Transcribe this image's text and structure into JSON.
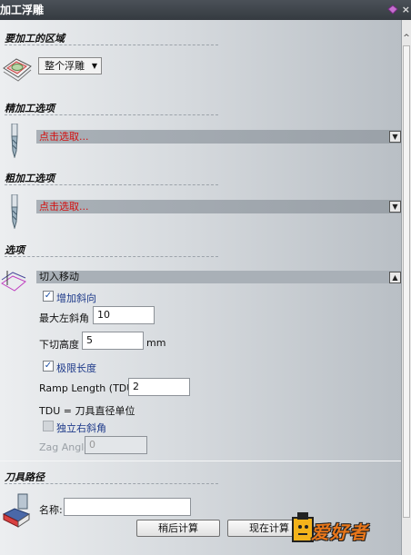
{
  "window": {
    "title": "加工浮雕"
  },
  "sections": {
    "area": {
      "title": "要加工的区域",
      "dropdown_value": "整个浮雕"
    },
    "finish": {
      "title": "精加工选项",
      "tool_placeholder": "点击选取..."
    },
    "rough": {
      "title": "粗加工选项",
      "tool_placeholder": "点击选取..."
    },
    "options": {
      "title": "选项",
      "subheader": "切入移动",
      "add_ramp_label": "增加斜向",
      "add_ramp_checked": true,
      "max_left_angle_label": "最大左斜角",
      "max_left_angle_value": "10",
      "plunge_height_label": "下切高度",
      "plunge_height_value": "5",
      "plunge_height_unit": "mm",
      "limit_length_label": "极限长度",
      "limit_length_checked": true,
      "ramp_length_label": "Ramp Length (TDU)",
      "ramp_length_value": "2",
      "tdu_note": "TDU = 刀具直径单位",
      "independent_right_label": "独立右斜角",
      "independent_right_checked": false,
      "zag_angle_label": "Zag Angle",
      "zag_angle_value": "0"
    },
    "toolpath": {
      "title": "刀具路径",
      "name_label": "名称:",
      "name_value": "",
      "calc_later_label": "稍后计算",
      "calc_now_label": "现在计算"
    }
  },
  "watermark": {
    "text": "爱好者"
  },
  "colors": {
    "title_bg": "#3e444a",
    "pick_text": "#d41010",
    "accent_blue": "#1e3a8a"
  }
}
